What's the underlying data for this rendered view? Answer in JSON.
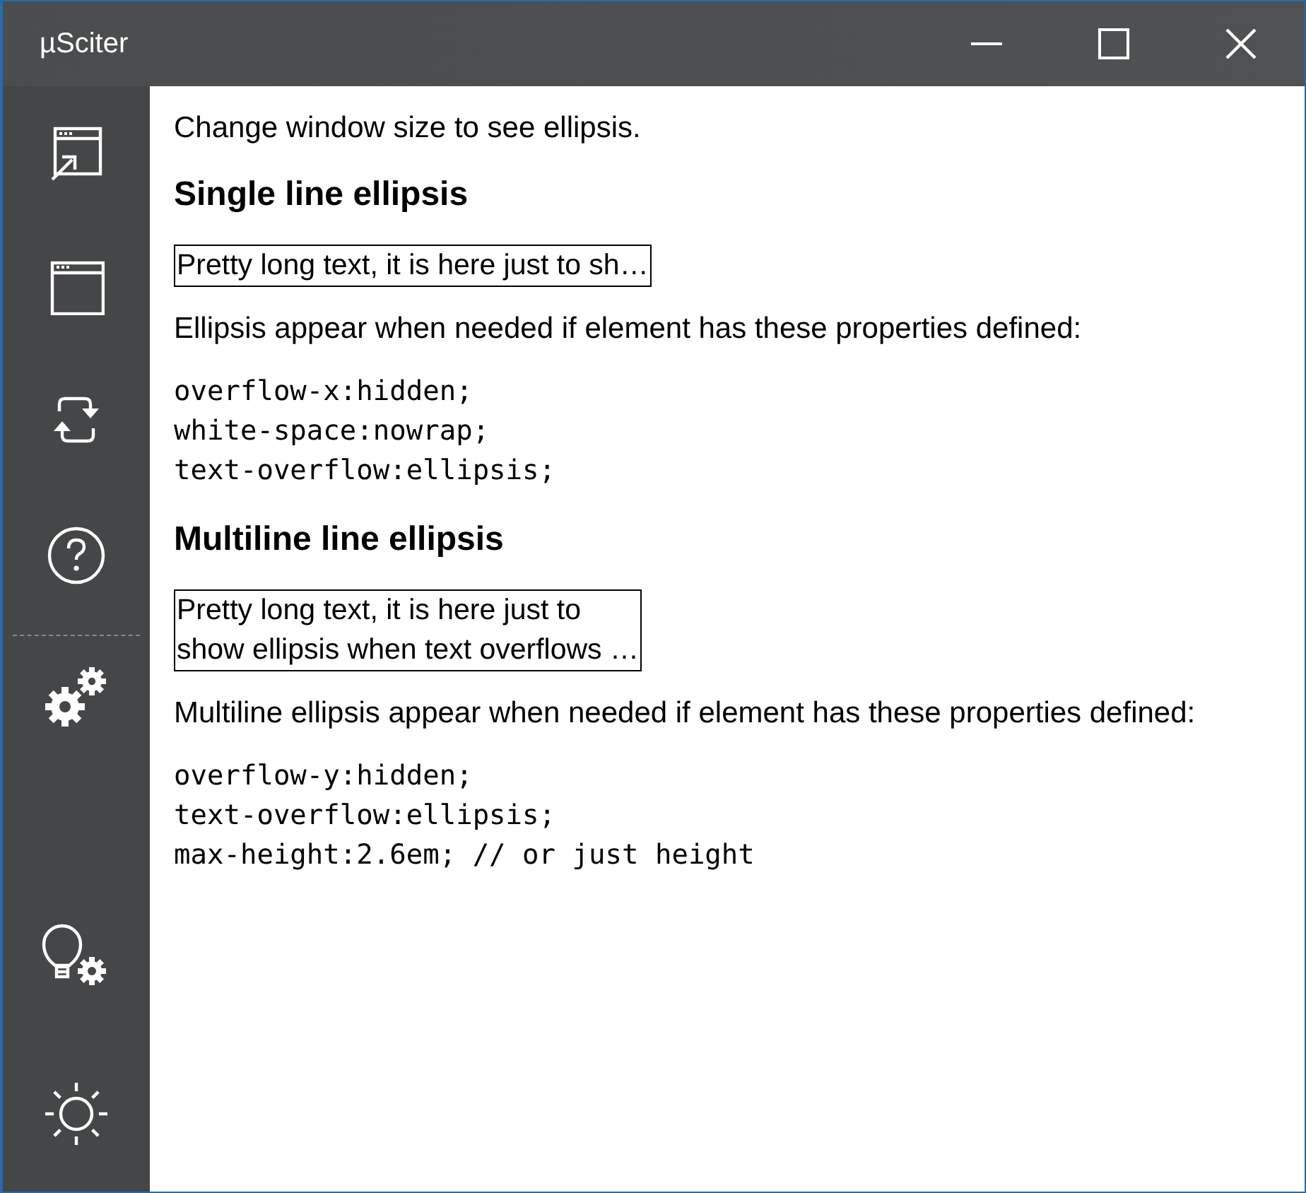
{
  "window": {
    "title": "µSciter"
  },
  "content": [
    {
      "kind": "paragraph",
      "text": "Change window size to see ellipsis."
    },
    {
      "kind": "heading",
      "text": "Single line ellipsis"
    },
    {
      "kind": "box",
      "lines": [
        "Pretty long text, it is here just to sh…"
      ]
    },
    {
      "kind": "paragraph",
      "text": "Ellipsis appear when needed if element has these properties defined:"
    },
    {
      "kind": "code",
      "lines": [
        "overflow-x:hidden;",
        "white-space:nowrap;",
        "text-overflow:ellipsis;"
      ]
    },
    {
      "kind": "heading",
      "text": "Multiline line ellipsis"
    },
    {
      "kind": "box",
      "lines": [
        "Pretty long text, it is here just to",
        "show ellipsis when text overflows …"
      ]
    },
    {
      "kind": "paragraph",
      "text": "Multiline ellipsis appear when needed if element has these properties defined:"
    },
    {
      "kind": "code",
      "lines": [
        "overflow-y:hidden;",
        "text-overflow:ellipsis;",
        "max-height:2.6em; // or just height"
      ]
    }
  ]
}
